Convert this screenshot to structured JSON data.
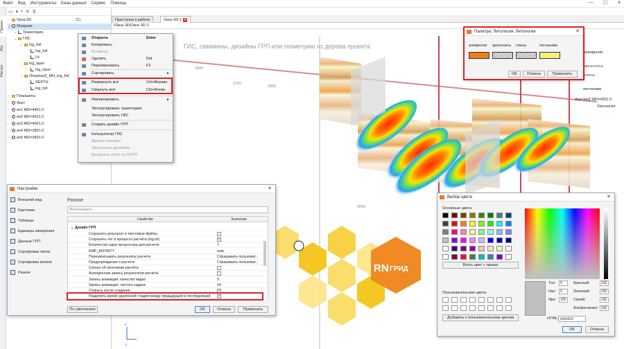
{
  "menu": [
    "Файл",
    "Вид",
    "Инструменты",
    "Базы данных",
    "Сервис",
    "Помощь"
  ],
  "side_tabs": [
    "Проект",
    "Лог",
    "Расчет"
  ],
  "tree": {
    "items": [
      {
        "label": "Окна 3D",
        "count": "(1)",
        "level": 0,
        "icon": "folder"
      },
      {
        "label": "Опорная",
        "level": 0,
        "icon": "well",
        "selected": true
      },
      {
        "label": "Траектория",
        "level": 1,
        "icon": "trajectory"
      },
      {
        "label": "ГИС",
        "level": 1,
        "icon": "folder"
      },
      {
        "label": "log_full",
        "level": 2,
        "icon": "folder"
      },
      {
        "label": "log_full",
        "level": 3,
        "icon": "log"
      },
      {
        "label": "Lit",
        "level": 3,
        "icon": "log"
      },
      {
        "label": "log_layer",
        "level": 2,
        "icon": "folder"
      },
      {
        "label": "log_layer",
        "level": 3,
        "icon": "log"
      },
      {
        "label": "Опорная2_MD_log_full",
        "level": 2,
        "icon": "folder"
      },
      {
        "label": "DEPTH",
        "level": 3,
        "icon": "log"
      },
      {
        "label": "log_full",
        "level": 3,
        "icon": "log"
      },
      {
        "label": "Планшеты",
        "level": 0,
        "icon": "folder"
      },
      {
        "label": "Факт",
        "level": 0,
        "icon": "well"
      },
      {
        "label": "ип1 MD=4401.0",
        "level": 0,
        "icon": "well"
      },
      {
        "label": "ип2 MD=4201.0",
        "level": 0,
        "icon": "well"
      },
      {
        "label": "ип3 MD=4001.0",
        "level": 0,
        "icon": "well"
      },
      {
        "label": "ип4 MD=3801.0",
        "level": 0,
        "icon": "well"
      },
      {
        "label": "ип5 MD=3601.0",
        "level": 0,
        "icon": "well"
      }
    ]
  },
  "tabs": [
    {
      "label": "Приступая к работе"
    },
    {
      "label": "Окно 3D-1",
      "active": true
    }
  ],
  "breadcrumb": "/Окна 3D/Окно 3D-1",
  "viewport": {
    "hint": "ГИС, скважины, дизайны ГРП или геометрию из дерева проекта",
    "md_labels": [
      "2600",
      "2750",
      "2850",
      "3050"
    ],
    "legend": [
      "алевролит",
      "аргиллиты",
      "глины",
      "песчаники"
    ],
    "well_caption": "Факт/ип2 MD=4201.0",
    "track_caption": "Литология",
    "logo_text": "ГРИД",
    "axis": [
      "z",
      "y"
    ]
  },
  "context_menu": {
    "items": [
      {
        "label": "Открыть",
        "shortcut": "Enter",
        "bold": true
      },
      {
        "label": "Копировать"
      },
      {
        "label": "Вставить",
        "disabled": true
      },
      {
        "label": "Удалить",
        "shortcut": "Del"
      },
      {
        "label": "Переименовать",
        "shortcut": "F2"
      },
      {
        "label": "Сортировать",
        "submenu": true
      },
      {
        "label": "Развернуть всё",
        "shortcut": "Ctrl+Вправо"
      },
      {
        "label": "Свернуть всё",
        "shortcut": "Ctrl+Влево"
      },
      {
        "label": "Импортировать",
        "submenu": true
      },
      {
        "label": "Экспортировать траекторию"
      },
      {
        "label": "Экспортировать ГИС"
      },
      {
        "label": "Создать дизайн ГРП"
      },
      {
        "label": "Калькулятор ГИС"
      },
      {
        "label": "Мульти-планшет",
        "disabled": true
      },
      {
        "label": "Экспертиза дизайнов",
        "disabled": true
      },
      {
        "label": "Выгрузить отчёт по МГРП",
        "disabled": true
      }
    ]
  },
  "settings": {
    "title": "Настройки",
    "nav": [
      "Внешний вид",
      "Картожки",
      "Таблицы",
      "Единицы измерения",
      "Данные ГРП",
      "Сортировка типов",
      "Сортировка кнопок",
      "Разное"
    ],
    "section": "Разное",
    "filter_placeholder": "Фильтровать...",
    "col_property": "Свойство",
    "col_value": "Значение",
    "group": "Дизайн ГРП",
    "rows": [
      {
        "name": "Сохранять результат в текстовые файлы",
        "value": "",
        "check": "off"
      },
      {
        "name": "Сохранять лог в процессе расчёта (log.txt)",
        "value": "",
        "check": "on"
      },
      {
        "name": "Количество ядер процессора для расчета",
        "value": "7"
      },
      {
        "name": "KMP_AFFINITY",
        "value": "auto"
      },
      {
        "name": "Перезаписывать результаты расчёта",
        "value": "Спрашивать пользоват..."
      },
      {
        "name": "Предупреждения о расчёте",
        "value": "Спрашивать пользоват..."
      },
      {
        "name": "Сигнал об окончании расчёта",
        "value": "",
        "check": "off"
      },
      {
        "name": "Асинхронная запись результатов расчёта",
        "value": "",
        "check": "off"
      },
      {
        "name": "Запись анимации: качество видео",
        "value": "9"
      },
      {
        "name": "Запись анимации: частота кадров",
        "value": "24"
      },
      {
        "name": "Открыть после создания",
        "value": "",
        "check": "on"
      },
      {
        "name": "Разделить время удаленной стадии между предыдущей и последующей",
        "value": "",
        "check": "on"
      }
    ],
    "btn_default": "По умолчанию",
    "btn_ok": "OK",
    "btn_cancel": "Отмена",
    "btn_apply": "Применить"
  },
  "palette": {
    "title": "Палитра: Литология: Литология",
    "items": [
      {
        "label": "алевролит",
        "color": "#f07c16"
      },
      {
        "label": "аргиллиты",
        "color": "#cfcfcf"
      },
      {
        "label": "глины",
        "color": "#d8d8d8"
      },
      {
        "label": "песчаники",
        "color": "#f8f07a"
      }
    ],
    "btn_ok": "OK",
    "btn_cancel": "Отмена",
    "btn_apply": "Применить"
  },
  "color_picker": {
    "title": "Выбор цвета",
    "basic_label": "Основные цвета",
    "pick_screen": "Взять цвет с экрана",
    "custom_label": "Пользовательские цвета",
    "add_custom": "Добавить к пользовательским цветам",
    "fields": [
      {
        "label": "Тон:",
        "value": "0"
      },
      {
        "label": "Нас:",
        "value": "0"
      },
      {
        "label": "Ярк:",
        "value": "192"
      },
      {
        "label": "Красный:",
        "value": "192"
      },
      {
        "label": "Зеленый:",
        "value": "192"
      },
      {
        "label": "Синий:",
        "value": "192"
      },
      {
        "label": "Альфа-канал:",
        "value": "192"
      }
    ],
    "html_label": "HTML:",
    "html_value": "#c0c0c0",
    "btn_ok": "OK",
    "btn_cancel": "Отмена",
    "current_color": "#c0c0c0",
    "basic_colors": [
      "#000000",
      "#800000",
      "#804000",
      "#808000",
      "#408000",
      "#008000",
      "#408080",
      "#004080",
      "#404040",
      "#ff0000",
      "#ff8000",
      "#ffff00",
      "#80ff00",
      "#00ff00",
      "#00ffff",
      "#0080ff",
      "#808080",
      "#ff0080",
      "#ff80c0",
      "#ffff80",
      "#80ff80",
      "#80ffff",
      "#80c0ff",
      "#8080ff",
      "#c0c0c0",
      "#8000ff",
      "#ff00ff",
      "#ff80ff",
      "#c0c0ff",
      "#0000ff",
      "#0000a0",
      "#000080",
      "#ffffff",
      "#400080",
      "#800080",
      "#a000a0",
      "#ffc0c0",
      "#ffe0c0",
      "#e0ffc0",
      "#ffffff",
      "#ffffff",
      "#800040",
      "#ff0040",
      "#408040",
      "#00c0c0",
      "#4080c0",
      "#8000c0",
      "#ffffff"
    ]
  }
}
